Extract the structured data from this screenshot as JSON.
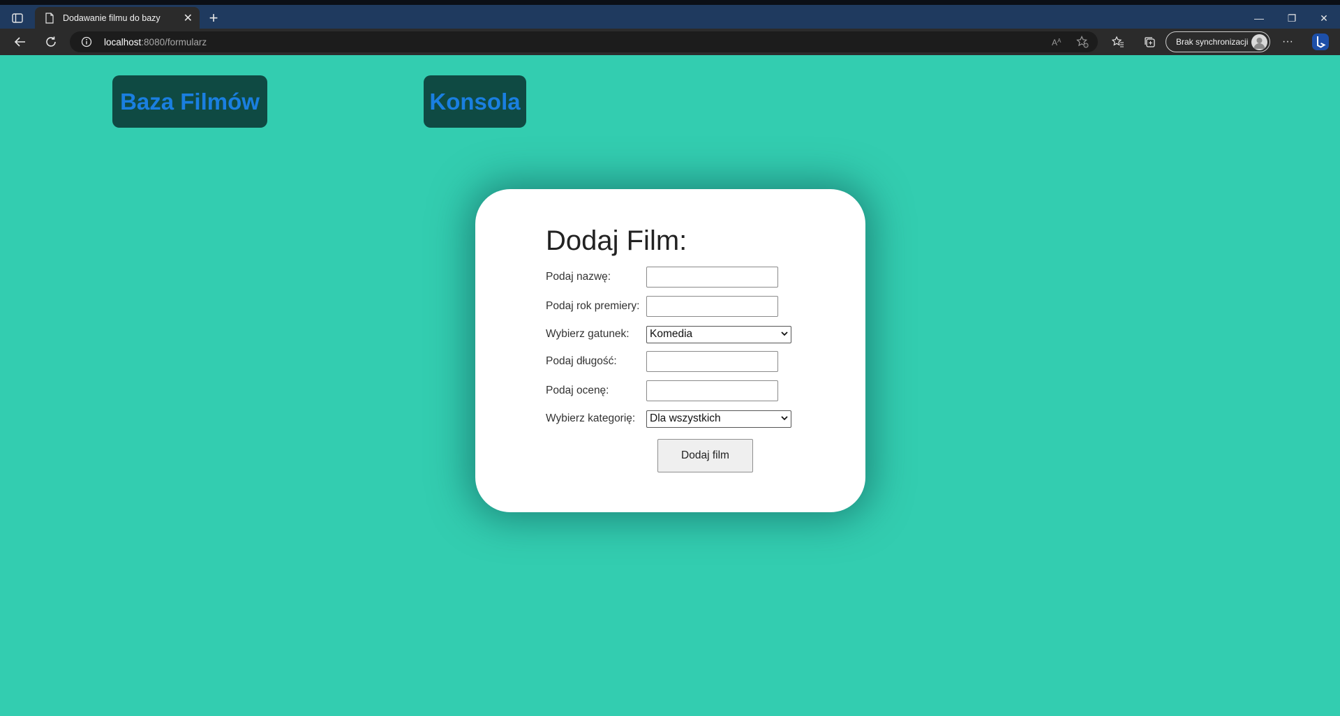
{
  "browser": {
    "tab": {
      "title": "Dodawanie filmu do bazy",
      "close": "✕"
    },
    "new_tab": "+",
    "window_controls": {
      "minimize": "—",
      "restore": "❐",
      "close": "✕"
    },
    "address": {
      "host": "localhost",
      "path": ":8080/formularz"
    },
    "sync_button": "Brak synchronizacji",
    "more": "···"
  },
  "nav": {
    "films": "Baza Filmów",
    "console": "Konsola"
  },
  "form": {
    "title": "Dodaj Film:",
    "fields": {
      "name_label": "Podaj nazwę:",
      "name_value": "",
      "year_label": "Podaj rok premiery:",
      "year_value": "",
      "genre_label": "Wybierz gatunek:",
      "genre_value": "Komedia",
      "length_label": "Podaj długość:",
      "length_value": "",
      "rating_label": "Podaj ocenę:",
      "rating_value": "",
      "category_label": "Wybierz kategorię:",
      "category_value": "Dla wszystkich"
    },
    "submit": "Dodaj film"
  },
  "colors": {
    "page_bg": "#33cdb0",
    "nav_bg": "#0f4a43",
    "nav_text": "#1a7fe0",
    "card_bg": "#ffffff"
  }
}
